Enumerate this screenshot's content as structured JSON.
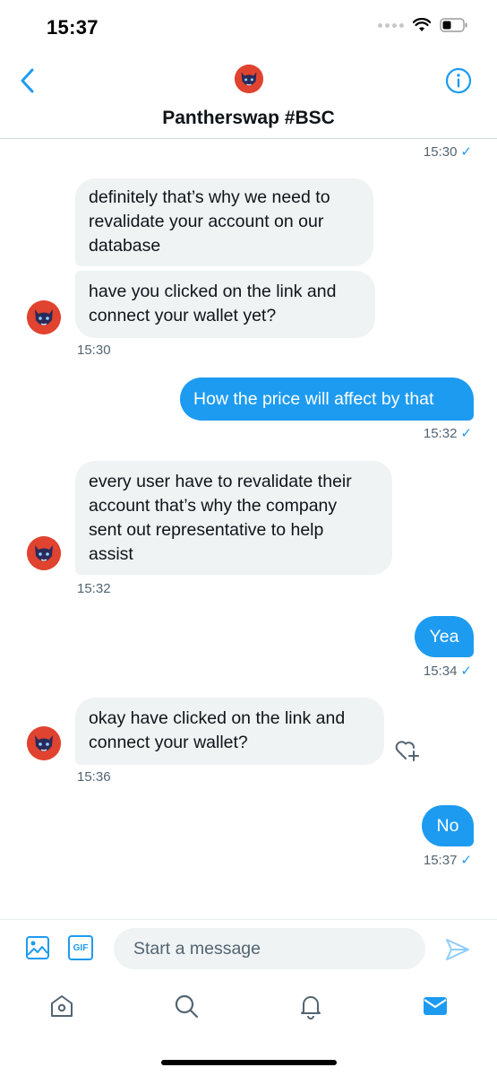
{
  "status_bar": {
    "time": "15:37"
  },
  "header": {
    "title": "Pantherswap #BSC"
  },
  "messages": [
    {
      "time": "15:30",
      "check": "✓"
    },
    {
      "text": "definitely that’s why we need to",
      "line2": "revalidate your account on our",
      "line3": "database"
    },
    {
      "text": "have you clicked on the link and",
      "line2": "connect your wallet yet?"
    },
    {
      "time": "15:30"
    },
    {
      "text": "How the price will affect by that"
    },
    {
      "time": "15:32",
      "check": "✓"
    },
    {
      "text": "every user have to revalidate their",
      "line2": "account that’s why the company",
      "line3": "sent out representative to help",
      "line4": "assist"
    },
    {
      "time": "15:32"
    },
    {
      "text": "Yea"
    },
    {
      "time": "15:34",
      "check": "✓"
    },
    {
      "text": "okay have clicked on the link and",
      "line2": "connect your wallet?"
    },
    {
      "time": "15:36"
    },
    {
      "text": "No"
    },
    {
      "time": "15:37",
      "check": "✓"
    }
  ],
  "composer": {
    "gif_label": "GIF",
    "placeholder": "Start a message"
  },
  "colors": {
    "accent": "#1d9bf0",
    "incoming_bubble": "#eff3f4",
    "avatar_bg": "#e0432f"
  },
  "icons": [
    "chevron-left-icon",
    "info-icon",
    "image-icon",
    "gif-icon",
    "send-icon",
    "home-icon",
    "search-icon",
    "bell-icon",
    "mail-icon",
    "heart-plus-icon",
    "wifi-icon",
    "battery-icon"
  ]
}
